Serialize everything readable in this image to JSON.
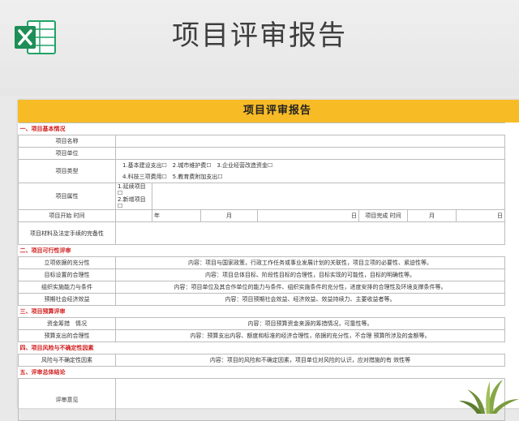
{
  "banner": {
    "title": "项目评审报告",
    "app_icon": "excel-icon"
  },
  "sheet": {
    "title": "项目评审报告",
    "sections": [
      "一、项目基本情况",
      "二、项目可行性评审",
      "三、项目预算评审",
      "四、项目风险与不确定性因素",
      "五、评审总体结论"
    ],
    "basic": {
      "name_label": "项目名称",
      "unit_label": "项目单位",
      "type_label": "项目类型",
      "type_options": [
        "1.基本建设支出☐",
        "2.城市维护费☐",
        "3.企业经营改造资金☐",
        "4.科技三项费用☐",
        "5.教育费附加支出☐"
      ],
      "attr_label": "项目属性",
      "attr_options": [
        "1.延续项目☐",
        "2.新增项目☐"
      ],
      "start_label": "项目开始 时间",
      "date_year": "年",
      "date_month": "月",
      "date_day": "日",
      "end_label": "项目完成 时间",
      "docs_label": "项目材料及法定手续的完备性"
    },
    "feasibility": [
      {
        "label": "立项依据的充分性",
        "content": "内容：项目与国家政策，行政工作任务或事业发展计划的关联性，项目立项的必要性、紧迫性等。"
      },
      {
        "label": "目标设置的合理性",
        "content": "内容：项目总体目标、阶段性目标的合理性，目标实现的可能性，目标的明确性等。"
      },
      {
        "label": "组织实施能力与条件",
        "content": "内容：项目单位及其合作单位的能力与条件、组织实施条件的充分性，进度安排的合理性及环境支撑条件等。"
      },
      {
        "label": "预期社会经济效益",
        "content": "内容：项目预期社会效益、经济效益、效益持续力、主要收益者等。"
      }
    ],
    "budget": [
      {
        "label": "资金筹措　情况",
        "content": "内容：项目预算资金来源的筹措情况，可靠性等。"
      },
      {
        "label": "预算支出的合理性",
        "content": "内容：预算支出内容、额度和标准的经济合理性，依据的充分性，不合理 预算所涉及的金额等。"
      }
    ],
    "risk": [
      {
        "label": "风险与不确定性因素",
        "content": "内容：项目的风险和不确定因素，项目单位对风险的认识，应对措施的有 效性等"
      }
    ],
    "conclusion_label": "评审意见"
  },
  "colors": {
    "header_bg": "#f7bb26",
    "section_text": "#d11a1a",
    "excel_green": "#21a366"
  }
}
